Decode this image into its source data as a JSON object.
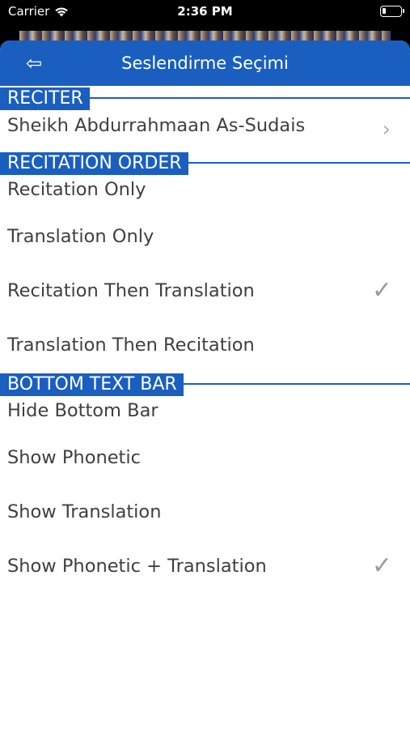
{
  "status_bar": {
    "carrier": "Carrier",
    "time": "2:36 PM"
  },
  "nav": {
    "title": "Seslendirme Seçimi",
    "back_icon": "back-arrow-icon"
  },
  "sections": {
    "reciter": {
      "header": "RECITER",
      "selected": "Sheikh Abdurrahmaan As-Sudais"
    },
    "recitation_order": {
      "header": "RECITATION ORDER",
      "options": [
        "Recitation Only",
        "Translation Only",
        "Recitation Then Translation",
        "Translation Then Recitation"
      ],
      "selected_index": 2
    },
    "bottom_text_bar": {
      "header": "BOTTOM TEXT BAR",
      "options": [
        "Hide Bottom Bar",
        "Show Phonetic",
        "Show Translation",
        "Show Phonetic + Translation"
      ],
      "selected_index": 3
    }
  },
  "colors": {
    "accent": "#1a5fbf",
    "text": "#3f3f3f",
    "checkmark": "#9a9a9a"
  }
}
